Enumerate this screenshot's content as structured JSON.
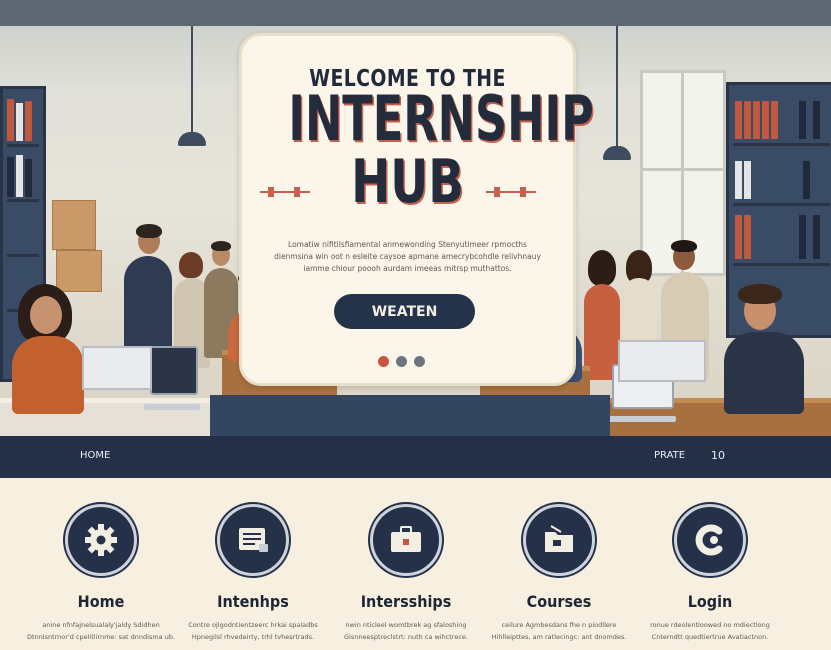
{
  "hero": {
    "welcome_line": "WELCOME TO THE",
    "title_line1": "INTERNSHIP",
    "title_line2": "HUB",
    "description": "Lomatiw nifitilsfiamental anmewonding Stenyutimeer rpmocths dienmsina win oot n esleite caysoe apmane amecrybcohdle relivhnauy iamme chiour poooh aurdam imeeas mitrsp muthattos.",
    "cta_label": "WEATEN",
    "carousel_dots": [
      "#c7553f",
      "#6f7580",
      "#6f7580"
    ]
  },
  "nav": {
    "home": "HOME",
    "prate": "PRATE",
    "count": "10"
  },
  "features": [
    {
      "icon": "gear-icon",
      "title": "Home",
      "desc": "anine nfnfajnelsualaly'jaldy Sdidhen Dtnnlsntrnor'd cpelitlirnme: sat dnndisma ub."
    },
    {
      "icon": "document-icon",
      "title": "Intenhps",
      "desc": "Contre ojlgodntientzeerc hrkai spaladbs Hpnegilsl rhvedeirty, trhl tvhesrtrads."
    },
    {
      "icon": "briefcase-icon",
      "title": "Intersships",
      "desc": "nwin nticleel womtbrek ag sfaloshing Gisnneesptreclstrt: nuth ca wihctrece."
    },
    {
      "icon": "folder-icon",
      "title": "Courses",
      "desc": "ceilure Agmbesdans fhe n piodllere Hihlleipttes, am ratlecingc: ant dnomdes."
    },
    {
      "icon": "login-icon",
      "title": "Login",
      "desc": "ronue rdeolentloowed no mdiectlong Cnterndtt quedtiertrue Avatiactnon."
    }
  ],
  "colors": {
    "navy": "#233048",
    "accent": "#c75f4e",
    "cream": "#f7f0e0"
  }
}
